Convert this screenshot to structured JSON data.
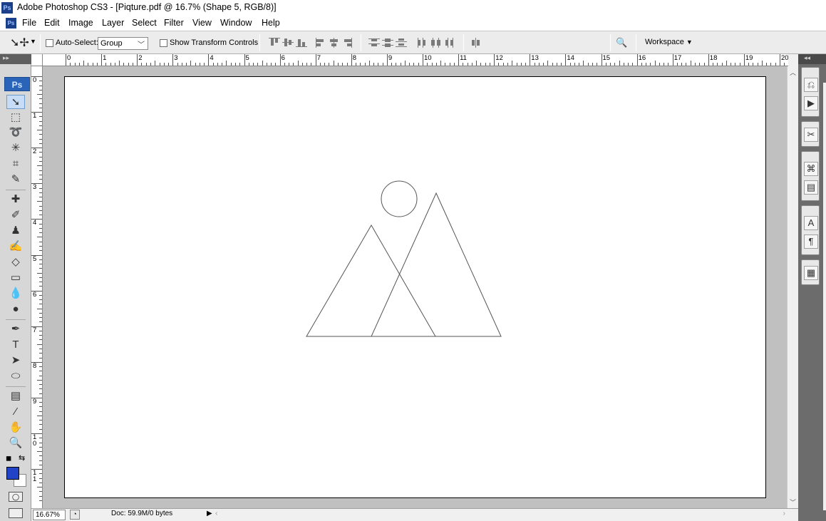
{
  "window": {
    "title": "Adobe Photoshop CS3 - [Piqture.pdf @ 16.7% (Shape 5, RGB/8)]",
    "app_badge": "Ps"
  },
  "menu": [
    "File",
    "Edit",
    "Image",
    "Layer",
    "Select",
    "Filter",
    "View",
    "Window",
    "Help"
  ],
  "options": {
    "auto_select_label": "Auto-Select:",
    "auto_select_checked": false,
    "group_value": "Group",
    "show_transform_label": "Show Transform Controls",
    "show_transform_checked": false,
    "workspace_label": "Workspace"
  },
  "ruler": {
    "top_numbers": [
      "0",
      "1",
      "2",
      "3",
      "4",
      "5",
      "6",
      "7",
      "8",
      "9",
      "10",
      "11",
      "12",
      "13",
      "14",
      "15",
      "16",
      "17",
      "18",
      "19",
      "20"
    ],
    "left_numbers": [
      "0",
      "1",
      "2",
      "3",
      "4",
      "5",
      "6",
      "7",
      "8",
      "9",
      "1 0",
      "1 1"
    ]
  },
  "tools": {
    "logo": "Ps",
    "foreground_color": "#2242c8",
    "background_color": "#ffffff",
    "items": [
      "move-tool",
      "marquee-tool",
      "lasso-tool",
      "magic-wand-tool",
      "crop-tool",
      "slice-tool",
      "healing-brush-tool",
      "brush-tool",
      "clone-stamp-tool",
      "history-brush-tool",
      "eraser-tool",
      "gradient-tool",
      "blur-tool",
      "dodge-tool",
      "pen-tool",
      "type-tool",
      "path-selection-tool",
      "shape-tool",
      "notes-tool",
      "eyedropper-tool",
      "hand-tool",
      "zoom-tool"
    ]
  },
  "status": {
    "zoom": "16.67%",
    "doc_info": "Doc: 59.9M/0 bytes"
  },
  "document": {
    "shapes": [
      "circle",
      "triangle-left",
      "triangle-right"
    ]
  }
}
